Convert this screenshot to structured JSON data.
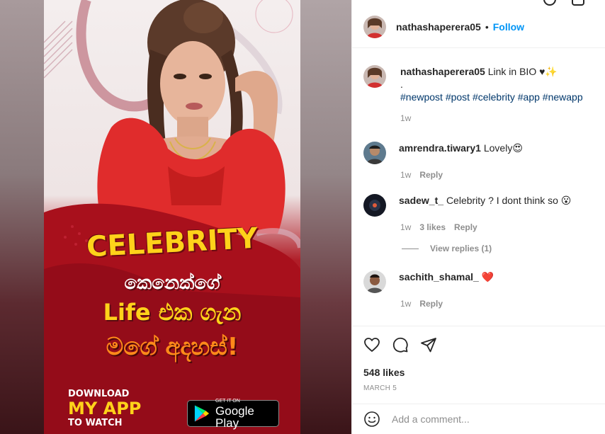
{
  "post": {
    "poster": {
      "line1": "CELEBRITY",
      "line2": "කෙනෙක්ගේ",
      "line3": "Life එක ගැන",
      "line4": "මගේ අදහස්!",
      "download_label": "DOWNLOAD",
      "app_label": "MY APP",
      "watch_label": "TO WATCH",
      "badge_small": "GET IT ON",
      "badge_big": "Google Play"
    }
  },
  "header": {
    "username": "nathashaperera05",
    "separator": "•",
    "follow_label": "Follow"
  },
  "caption": {
    "username": "nathashaperera05",
    "text": "Link in BIO ♥✨",
    "dot_line": ".",
    "hashtags": "#newpost #post #celebrity #app #newapp",
    "time": "1w"
  },
  "comments": [
    {
      "username": "amrendra.tiwary1",
      "text": "Lovely😍",
      "time": "1w",
      "reply_label": "Reply"
    },
    {
      "username": "sadew_t_",
      "text": "Celebrity ? I dont think so 😮",
      "time": "1w",
      "likes": "3 likes",
      "reply_label": "Reply"
    },
    {
      "username": "sachith_shamal_",
      "text": "❤️",
      "time": "1w",
      "reply_label": "Reply"
    }
  ],
  "view_replies": "View replies (1)",
  "actions": {
    "icons": [
      "heart-icon",
      "comment-icon",
      "share-icon"
    ],
    "likes": "548 likes",
    "date": "MARCH 5"
  },
  "composer": {
    "placeholder": "Add a comment...",
    "icon": "emoji-icon"
  },
  "colors": {
    "accent": "#0095f6",
    "hashtag": "#00376b",
    "muted": "#8e8e8e",
    "poster_red": "#b01e28",
    "poster_yellow": "#ffd21a"
  }
}
